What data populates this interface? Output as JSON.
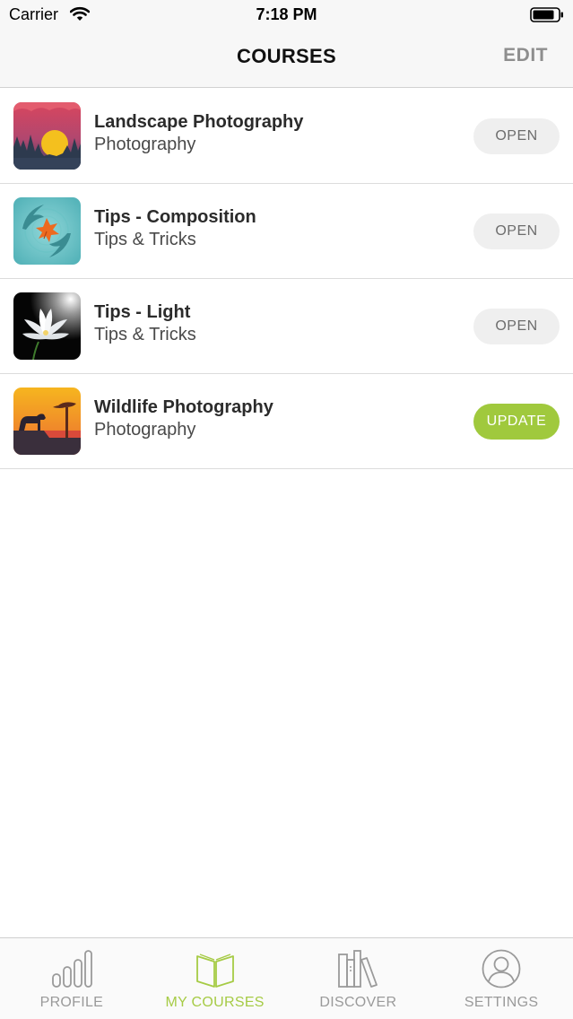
{
  "status_bar": {
    "carrier": "Carrier",
    "time": "7:18 PM",
    "icons": [
      "wifi-icon",
      "battery-icon"
    ]
  },
  "nav": {
    "title": "COURSES",
    "edit_label": "EDIT"
  },
  "courses": [
    {
      "title": "Landscape Photography",
      "category": "Photography",
      "action": "OPEN",
      "icon": "landscape-sunset-icon"
    },
    {
      "title": "Tips - Composition",
      "category": "Tips & Tricks",
      "action": "OPEN",
      "icon": "koi-fish-leaf-icon"
    },
    {
      "title": "Tips - Light",
      "category": "Tips & Tricks",
      "action": "OPEN",
      "icon": "lotus-flower-icon"
    },
    {
      "title": "Wildlife Photography",
      "category": "Photography",
      "action": "UPDATE",
      "icon": "lion-savanna-icon"
    }
  ],
  "tabs": [
    {
      "label": "PROFILE",
      "icon": "bar-chart-icon",
      "active": false
    },
    {
      "label": "MY COURSES",
      "icon": "open-book-icon",
      "active": true
    },
    {
      "label": "DISCOVER",
      "icon": "books-shelf-icon",
      "active": false
    },
    {
      "label": "SETTINGS",
      "icon": "user-circle-icon",
      "active": false
    }
  ],
  "colors": {
    "accent": "#a0c93d",
    "open_button_bg": "#efefef",
    "bar_bg": "#f7f7f7"
  }
}
